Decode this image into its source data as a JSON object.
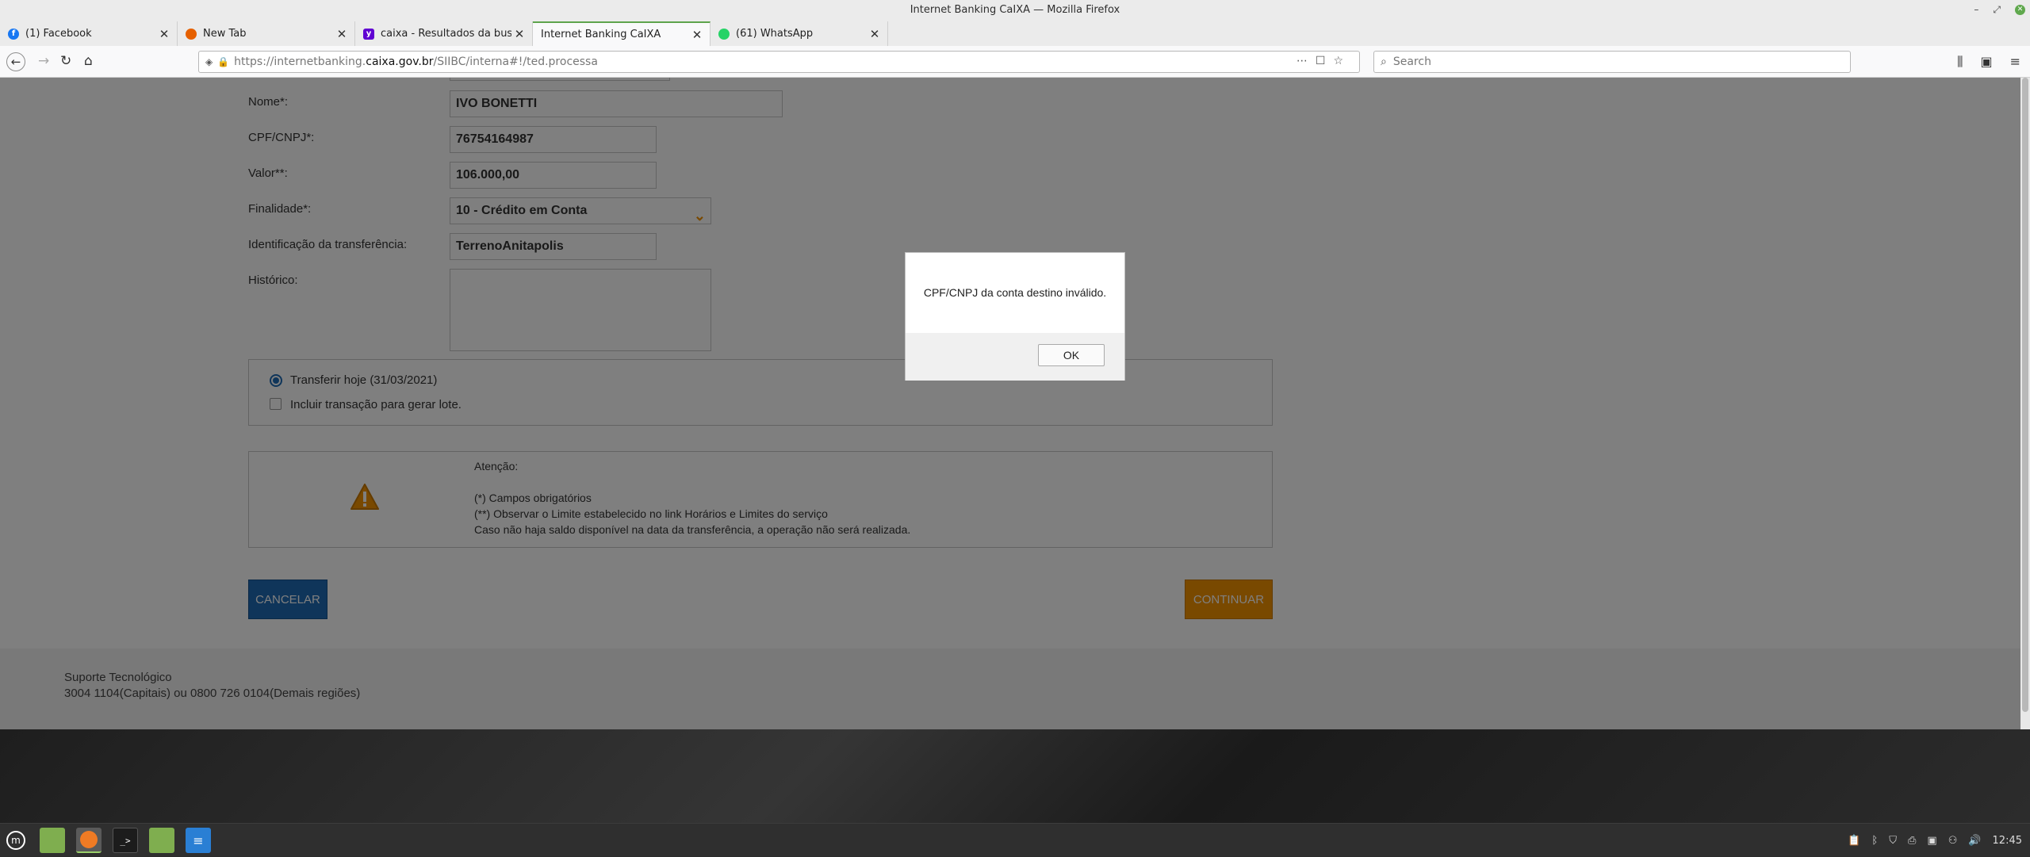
{
  "window": {
    "title": "Internet Banking CaIXA — Mozilla Firefox"
  },
  "tabs": [
    {
      "label": "(1) Facebook",
      "icon": "facebook-icon",
      "color": "#1877f2"
    },
    {
      "label": "New Tab",
      "icon": "firefox-icon",
      "color": "#e66000"
    },
    {
      "label": "caixa - Resultados da busca",
      "icon": "yahoo-icon",
      "color": "#6001d2"
    },
    {
      "label": "Internet Banking CaIXA",
      "icon": "caixa-icon",
      "color": "#1f6bb5"
    },
    {
      "label": "(61) WhatsApp",
      "icon": "whatsapp-icon",
      "color": "#25d366"
    }
  ],
  "url": {
    "prefix": "https://internetbanking.",
    "host": "caixa.gov.br",
    "suffix": "/SIIBC/interna#!/ted.processa"
  },
  "search": {
    "placeholder": "Search"
  },
  "form": {
    "nome_label": "Nome*:",
    "nome_value": "IVO BONETTI",
    "cpf_label": "CPF/CNPJ*:",
    "cpf_value": "76754164987",
    "valor_label": "Valor**:",
    "valor_value": "106.000,00",
    "finalidade_label": "Finalidade*:",
    "finalidade_value": "10 - Crédito em Conta",
    "ident_label": "Identificação da transferência:",
    "ident_value": "TerrenoAnitapolis",
    "historico_label": "Histórico:",
    "historico_value": ""
  },
  "options": {
    "transfer_today": "Transferir hoje (31/03/2021)",
    "include_batch": "Incluir transação para gerar lote."
  },
  "notice": {
    "title": "Atenção:",
    "line1": "(*) Campos obrigatórios",
    "line2": "(**) Observar o Limite estabelecido no link Horários e Limites do serviço",
    "line3": "Caso não haja saldo disponível na data da transferência, a operação não será realizada."
  },
  "buttons": {
    "cancel": "CANCELAR",
    "continue": "CONTINUAR"
  },
  "footer": {
    "title": "Suporte Tecnológico",
    "phones": "3004 1104(Capitais) ou 0800 726 0104(Demais regiões)"
  },
  "modal": {
    "message": "CPF/CNPJ da conta destino inválido.",
    "ok": "OK"
  },
  "taskbar": {
    "clock": "12:45"
  },
  "colors": {
    "caixa_blue": "#1f6bb5",
    "caixa_orange": "#f39200"
  }
}
